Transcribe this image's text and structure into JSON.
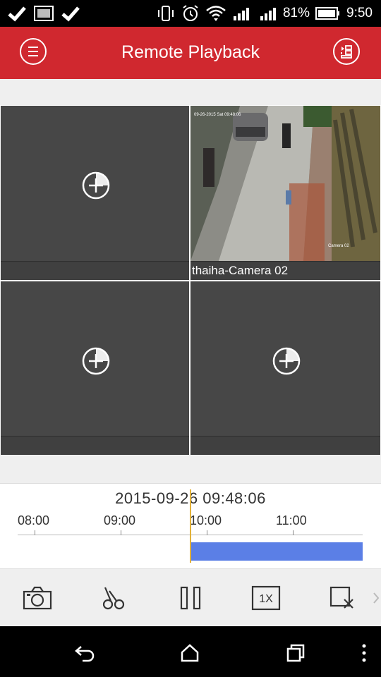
{
  "status_bar": {
    "battery": "81%",
    "time": "9:50"
  },
  "app_bar": {
    "title": "Remote Playback"
  },
  "grid": {
    "tiles": [
      {
        "label": "",
        "has_video": false
      },
      {
        "label": "thaiha-Camera 02",
        "has_video": true,
        "overlay_date": "09-26-2015 Sat 09:48:06",
        "overlay_cam": "Camera 02"
      },
      {
        "label": "",
        "has_video": false
      },
      {
        "label": "",
        "has_video": false
      }
    ]
  },
  "timeline": {
    "datetime": "2015-09-26 09:48:06",
    "ticks": [
      "08:00",
      "09:00",
      "10:00",
      "11:00"
    ]
  },
  "toolbar": {
    "items": [
      "camera-icon",
      "scissors-icon",
      "pause-icon",
      "speed-1x-icon",
      "close-window-icon"
    ],
    "speed_label": "1X"
  },
  "colors": {
    "accent": "#d0282f",
    "record_bar": "#5b7fe6",
    "cursor": "#e2b23a"
  }
}
